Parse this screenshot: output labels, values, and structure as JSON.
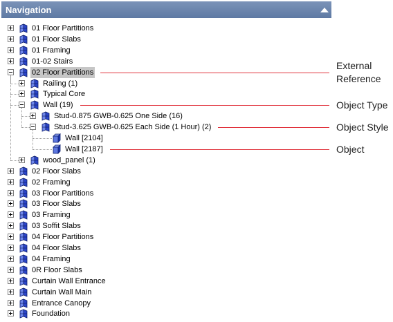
{
  "header": {
    "title": "Navigation",
    "collapse_icon": "triangle-up-icon"
  },
  "tree": [
    {
      "label": "01 Floor Partitions",
      "level": 0,
      "state": "collapsed",
      "icon": "object-type-icon"
    },
    {
      "label": "01 Floor Slabs",
      "level": 0,
      "state": "collapsed",
      "icon": "object-type-icon"
    },
    {
      "label": "01 Framing",
      "level": 0,
      "state": "collapsed",
      "icon": "object-type-icon"
    },
    {
      "label": "01-02 Stairs",
      "level": 0,
      "state": "collapsed",
      "icon": "object-type-icon"
    },
    {
      "label": "02 Floor Partitions",
      "level": 0,
      "state": "expanded",
      "icon": "object-type-icon",
      "selected": true
    },
    {
      "label": "Railing (1)",
      "level": 1,
      "state": "collapsed",
      "icon": "object-type-icon"
    },
    {
      "label": "Typical Core",
      "level": 1,
      "state": "collapsed",
      "icon": "object-type-icon"
    },
    {
      "label": "Wall (19)",
      "level": 1,
      "state": "expanded",
      "icon": "object-type-icon"
    },
    {
      "label": "Stud-0.875 GWB-0.625 One Side (16)",
      "level": 2,
      "state": "collapsed",
      "icon": "object-type-icon"
    },
    {
      "label": "Stud-3.625 GWB-0.625 Each Side (1 Hour) (2)",
      "level": 2,
      "state": "expanded",
      "icon": "object-type-icon"
    },
    {
      "label": "Wall [2104]",
      "level": 3,
      "state": "leaf",
      "icon": "wall-object-icon"
    },
    {
      "label": "Wall [2187]",
      "level": 3,
      "state": "leaf",
      "icon": "wall-object-icon"
    },
    {
      "label": "wood_panel (1)",
      "level": 1,
      "state": "collapsed",
      "icon": "object-type-icon"
    },
    {
      "label": "02 Floor Slabs",
      "level": 0,
      "state": "collapsed",
      "icon": "object-type-icon"
    },
    {
      "label": "02 Framing",
      "level": 0,
      "state": "collapsed",
      "icon": "object-type-icon"
    },
    {
      "label": "03 Floor Partitions",
      "level": 0,
      "state": "collapsed",
      "icon": "object-type-icon"
    },
    {
      "label": "03 Floor Slabs",
      "level": 0,
      "state": "collapsed",
      "icon": "object-type-icon"
    },
    {
      "label": "03 Framing",
      "level": 0,
      "state": "collapsed",
      "icon": "object-type-icon"
    },
    {
      "label": "03 Soffit Slabs",
      "level": 0,
      "state": "collapsed",
      "icon": "object-type-icon"
    },
    {
      "label": "04 Floor Partitions",
      "level": 0,
      "state": "collapsed",
      "icon": "object-type-icon"
    },
    {
      "label": "04 Floor Slabs",
      "level": 0,
      "state": "collapsed",
      "icon": "object-type-icon"
    },
    {
      "label": "04 Framing",
      "level": 0,
      "state": "collapsed",
      "icon": "object-type-icon"
    },
    {
      "label": "0R Floor Slabs",
      "level": 0,
      "state": "collapsed",
      "icon": "object-type-icon"
    },
    {
      "label": "Curtain Wall Entrance",
      "level": 0,
      "state": "collapsed",
      "icon": "object-type-icon"
    },
    {
      "label": "Curtain Wall Main",
      "level": 0,
      "state": "collapsed",
      "icon": "object-type-icon"
    },
    {
      "label": "Entrance Canopy",
      "level": 0,
      "state": "collapsed",
      "icon": "object-type-icon"
    },
    {
      "label": "Foundation",
      "level": 0,
      "state": "collapsed",
      "icon": "object-type-icon"
    }
  ],
  "annotations": [
    {
      "row": 4,
      "lines": [
        "External",
        "Reference"
      ]
    },
    {
      "row": 7,
      "lines": [
        "Object Type"
      ]
    },
    {
      "row": 9,
      "lines": [
        "Object Style"
      ]
    },
    {
      "row": 11,
      "lines": [
        "Object"
      ]
    }
  ],
  "colors": {
    "header": "#6882ab",
    "annotation_line": "#e0303a",
    "icon_blue": "#2b45c8",
    "selection": "#c6c6c6"
  }
}
